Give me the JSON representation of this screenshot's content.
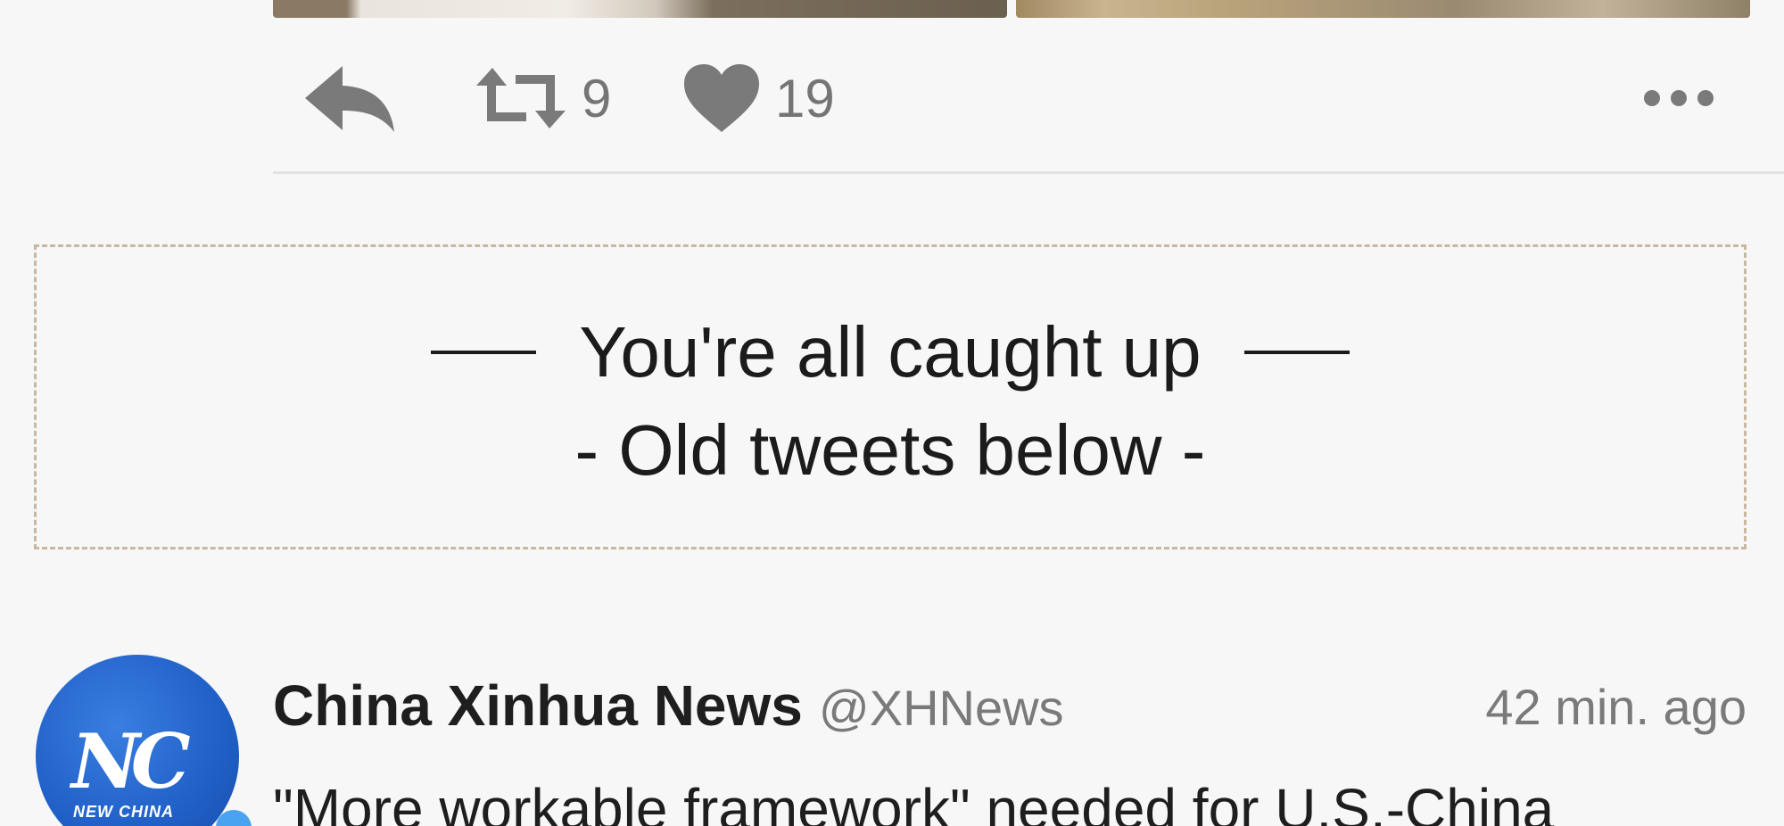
{
  "tweet_actions": {
    "retweet_count": "9",
    "like_count": "19"
  },
  "caught_up": {
    "title": "You're all caught up",
    "subtitle": "- Old tweets below -"
  },
  "tweet": {
    "name": "China Xinhua News",
    "handle": "@XHNews",
    "time": "42 min. ago",
    "text": "\"More workable framework\" needed for U.S.-China",
    "avatar_label": "NC",
    "avatar_caption": "NEW CHINA"
  },
  "icons": {
    "reply": "reply-icon",
    "retweet": "retweet-icon",
    "like": "heart-icon",
    "more": "more-icon",
    "verified": "verified-icon"
  },
  "colors": {
    "background": "#f7f7f7",
    "icon_gray": "#7a7a7a",
    "avatar_blue": "#1f5fc6",
    "dashed_border": "#c9b7a0"
  }
}
